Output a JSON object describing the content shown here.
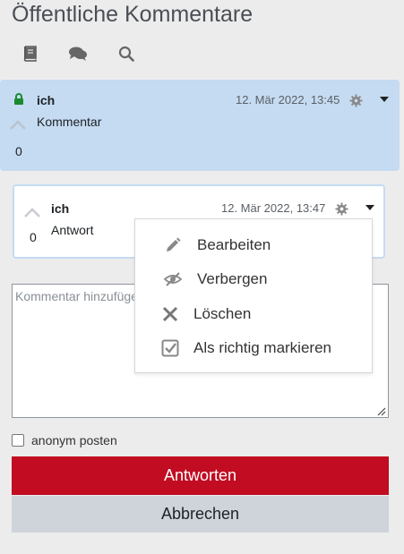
{
  "page": {
    "title": "Öffentliche Kommentare"
  },
  "toolbar": {
    "icons": [
      "book-icon",
      "comments-icon",
      "search-icon"
    ]
  },
  "comment": {
    "author": "ich",
    "text": "Kommentar",
    "date": "12. Mär 2022, 13:45",
    "votes": "0",
    "lock_icon": "lock-icon",
    "bg_color": "#c5dbf1"
  },
  "reply": {
    "author": "ich",
    "text": "Antwort",
    "date": "12. Mär 2022, 13:47",
    "votes": "0"
  },
  "menu": {
    "items": [
      {
        "label": "Bearbeiten",
        "icon": "pencil-icon"
      },
      {
        "label": "Verbergen",
        "icon": "eye-slash-icon"
      },
      {
        "label": "Löschen",
        "icon": "times-icon"
      },
      {
        "label": "Als richtig markieren",
        "icon": "check-square-icon"
      }
    ]
  },
  "form": {
    "placeholder": "Kommentar hinzufügen",
    "value": "",
    "anonymous_label": "anonym posten",
    "anonymous_checked": false
  },
  "buttons": {
    "submit_label": "Antworten",
    "cancel_label": "Abbrechen",
    "submit_color": "#c10c22",
    "cancel_color": "#ced4da"
  }
}
